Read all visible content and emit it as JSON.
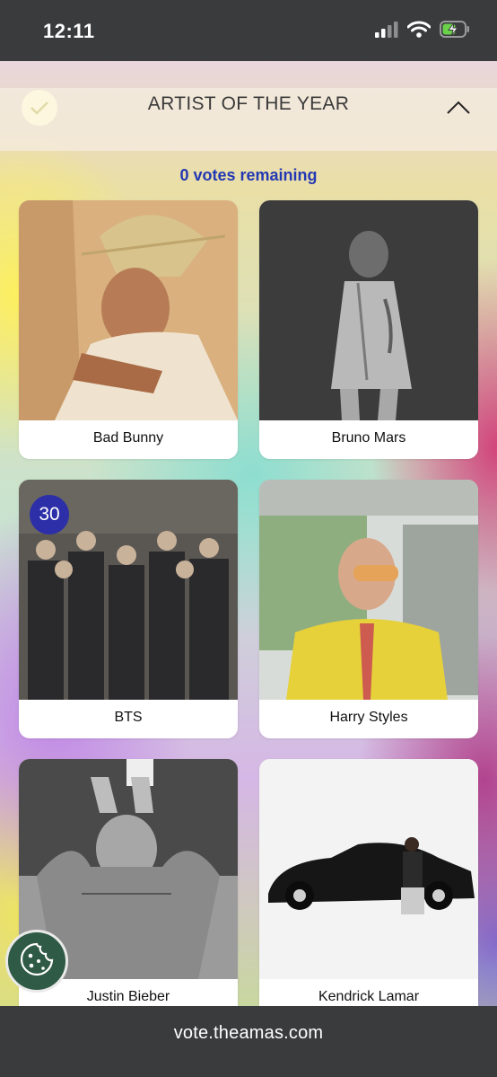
{
  "status_bar": {
    "time": "12:11",
    "icons": [
      "signal-icon",
      "wifi-icon",
      "battery-charging-icon"
    ]
  },
  "category": {
    "title": "ARTIST OF THE YEAR",
    "votes_remaining": "0 votes remaining"
  },
  "artists": [
    {
      "name": "Bad Bunny",
      "votes": null
    },
    {
      "name": "Bruno Mars",
      "votes": null
    },
    {
      "name": "BTS",
      "votes": "30"
    },
    {
      "name": "Harry Styles",
      "votes": null
    },
    {
      "name": "Justin Bieber",
      "votes": null
    },
    {
      "name": "Kendrick Lamar",
      "votes": null
    }
  ],
  "browser": {
    "url": "vote.theamas.com"
  },
  "colors": {
    "accent": "#2c2fa8",
    "votes_text": "#2338b3",
    "cookie_button": "#2f5a45",
    "chrome": "#3a3b3d"
  }
}
